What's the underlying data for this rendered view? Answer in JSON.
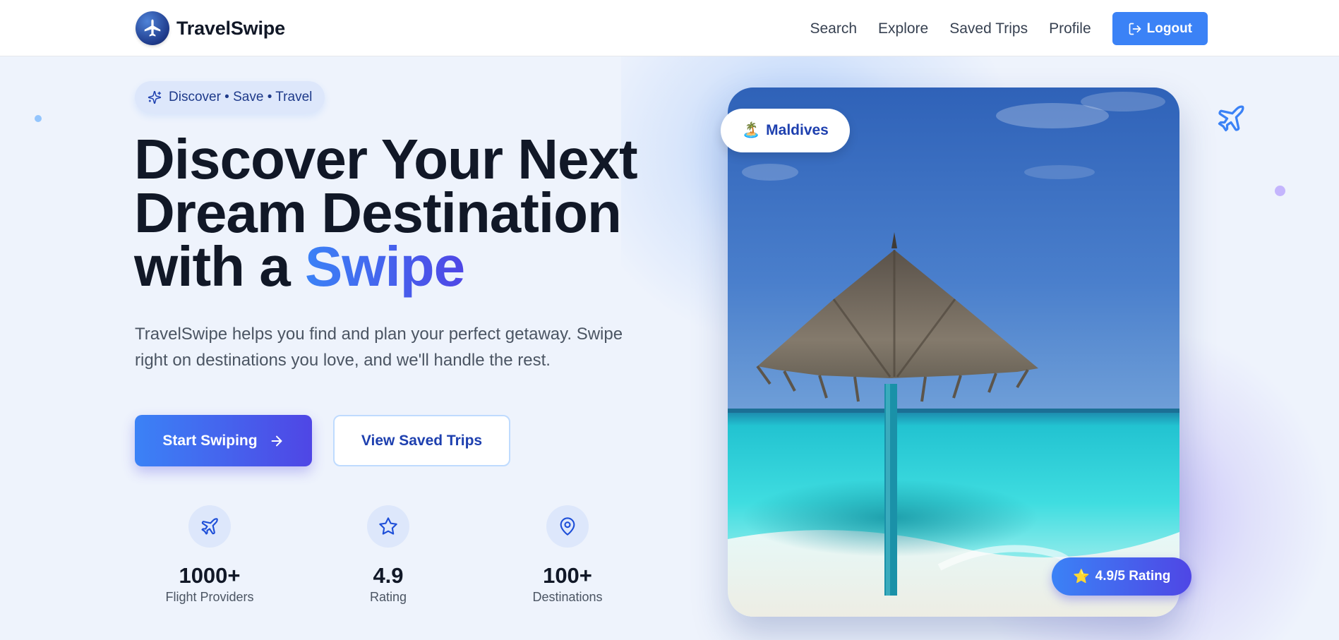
{
  "brand": {
    "name": "TravelSwipe",
    "logo_icon": "airplane-logo-icon"
  },
  "nav": {
    "links": [
      "Search",
      "Explore",
      "Saved Trips",
      "Profile"
    ],
    "logout_label": "Logout",
    "logout_icon": "logout-icon"
  },
  "hero": {
    "pill_icon": "sparkles-icon",
    "pill_text": "Discover • Save • Travel",
    "title_line1": "Discover Your Next",
    "title_line2": "Dream Destination",
    "title_line3_prefix": "with a ",
    "title_accent": "Swipe",
    "description": "TravelSwipe helps you find and plan your perfect getaway. Swipe right on destinations you love, and we'll handle the rest.",
    "primary_button": "Start Swiping",
    "primary_button_icon": "arrow-right-icon",
    "secondary_button": "View Saved Trips"
  },
  "stats": [
    {
      "icon": "airplane-icon",
      "value": "1000+",
      "label": "Flight Providers"
    },
    {
      "icon": "star-icon",
      "value": "4.9",
      "label": "Rating"
    },
    {
      "icon": "map-pin-icon",
      "value": "100+",
      "label": "Destinations"
    }
  ],
  "card": {
    "location_emoji": "🏝️",
    "location": "Maldives",
    "rating_emoji": "⭐",
    "rating": "4.9/5 Rating"
  },
  "colors": {
    "accent": "#3b82f6",
    "accent_gradient_end": "#4f46e5",
    "background": "#eef3fc",
    "text_primary": "#111827",
    "text_secondary": "#4b5563"
  }
}
